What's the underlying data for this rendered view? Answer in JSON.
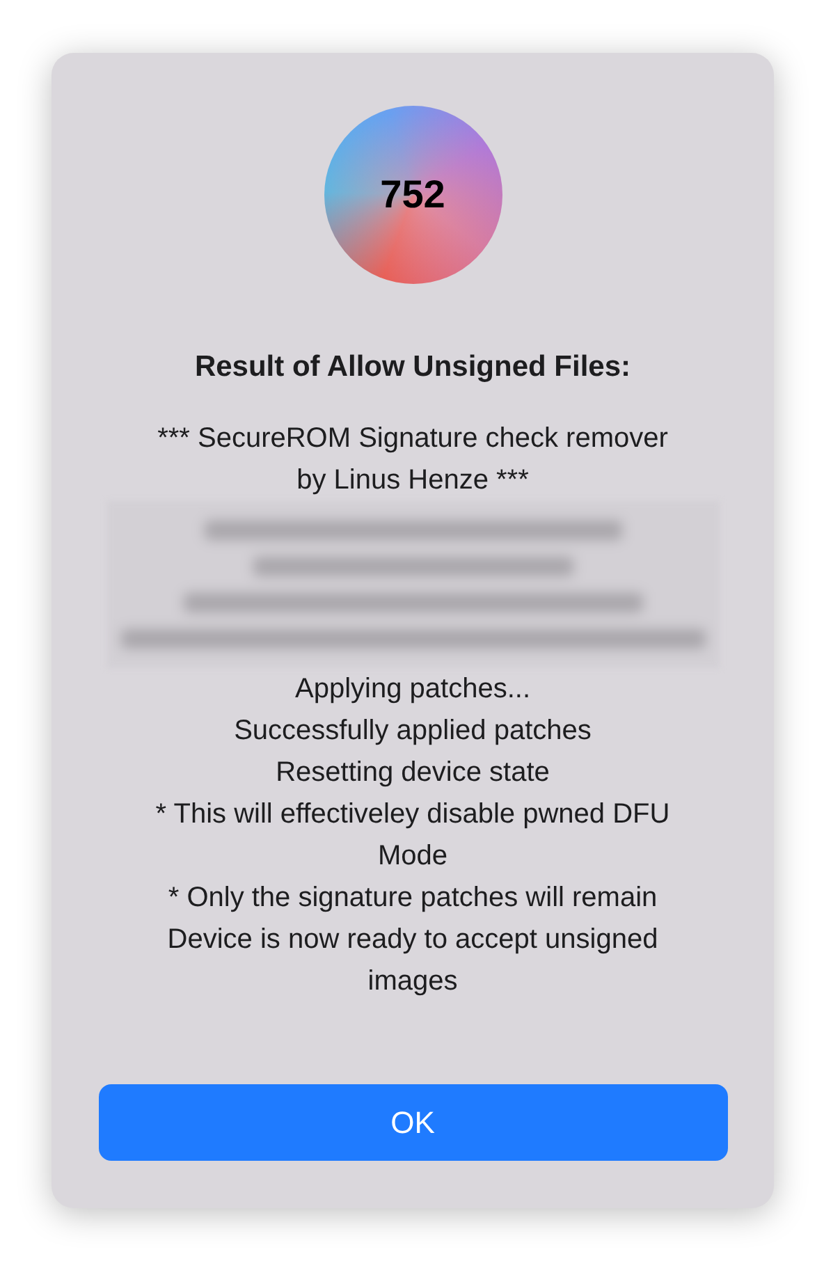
{
  "dialog": {
    "app_icon": {
      "label": "752"
    },
    "title": "Result of Allow Unsigned Files:",
    "message_before": [
      "*** SecureROM Signature check remover",
      "by Linus Henze ***"
    ],
    "message_after": [
      "Applying patches...",
      "Successfully applied patches",
      "Resetting device state",
      "* This will effectiveley disable pwned DFU Mode",
      "* Only the signature patches will remain",
      "Device is now ready to accept unsigned images"
    ],
    "buttons": [
      {
        "label": "OK",
        "default": true
      }
    ]
  }
}
